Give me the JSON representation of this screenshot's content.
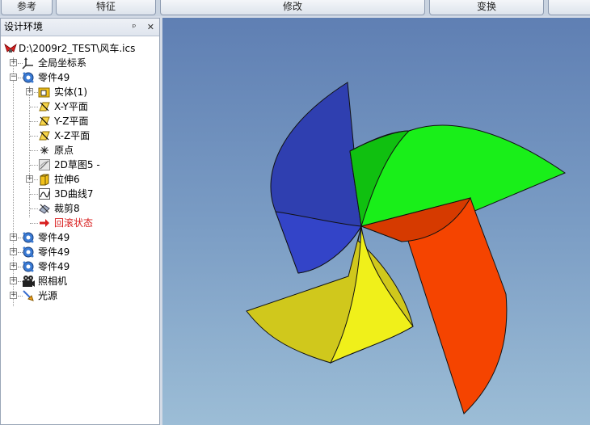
{
  "toolbar": {
    "tabs": [
      "参考",
      "特征",
      "修改",
      "变换"
    ]
  },
  "panel": {
    "title": "设计环境",
    "pin_glyph": "ᵖ",
    "close_glyph": "✕"
  },
  "tree": {
    "root": "D:\\2009r2_TEST\\风车.ics",
    "items": [
      {
        "label": "全局坐标系",
        "icon": "axes-icon"
      },
      {
        "label": "零件49",
        "icon": "part-icon"
      },
      {
        "label": "实体(1)",
        "icon": "solid-icon"
      },
      {
        "label": "X-Y平面",
        "icon": "plane-icon"
      },
      {
        "label": "Y-Z平面",
        "icon": "plane-icon"
      },
      {
        "label": "X-Z平面",
        "icon": "plane-icon"
      },
      {
        "label": "原点",
        "icon": "origin-icon"
      },
      {
        "label": "2D草图5 -",
        "icon": "sketch-icon"
      },
      {
        "label": "拉伸6",
        "icon": "extrude-icon"
      },
      {
        "label": "3D曲线7",
        "icon": "curve3d-icon"
      },
      {
        "label": "裁剪8",
        "icon": "trim-icon"
      },
      {
        "label": "回滚状态",
        "icon": "rollback-arrow-icon"
      },
      {
        "label": "零件49",
        "icon": "part-icon"
      },
      {
        "label": "零件49",
        "icon": "part-icon"
      },
      {
        "label": "零件49",
        "icon": "part-icon"
      },
      {
        "label": "照相机",
        "icon": "camera-icon"
      },
      {
        "label": "光源",
        "icon": "light-icon"
      }
    ]
  },
  "viewport": {
    "blade_colors": {
      "blue": "#2f3fb0",
      "green": "#19ef19",
      "red": "#f54400",
      "yellow": "#f0f01a"
    }
  }
}
